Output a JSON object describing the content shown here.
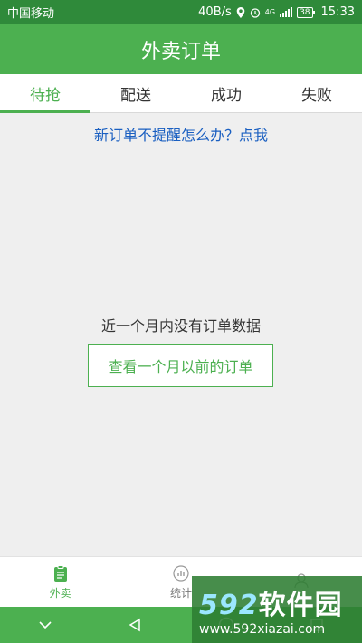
{
  "status_bar": {
    "carrier": "中国移动",
    "speed": "40B/s",
    "network": "4G",
    "battery": "38",
    "time": "15:33"
  },
  "header": {
    "title": "外卖订单"
  },
  "tabs": [
    {
      "label": "待抢",
      "active": true
    },
    {
      "label": "配送",
      "active": false
    },
    {
      "label": "成功",
      "active": false
    },
    {
      "label": "失败",
      "active": false
    }
  ],
  "help_link": "新订单不提醒怎么办？点我",
  "empty_state": {
    "message": "近一个月内没有订单数据",
    "button": "查看一个月以前的订单"
  },
  "bottom_nav": [
    {
      "label": "外卖",
      "icon": "clipboard-icon",
      "active": true
    },
    {
      "label": "统计",
      "icon": "chart-icon",
      "active": false
    },
    {
      "label": "",
      "icon": "user-icon",
      "active": false
    }
  ],
  "watermark": {
    "brand_num": "592",
    "brand_text": "软件园",
    "url": "www.592xiazai.com"
  },
  "colors": {
    "primary": "#4cb050",
    "status_bar": "#2f8a3a",
    "link": "#1a5fc1"
  }
}
